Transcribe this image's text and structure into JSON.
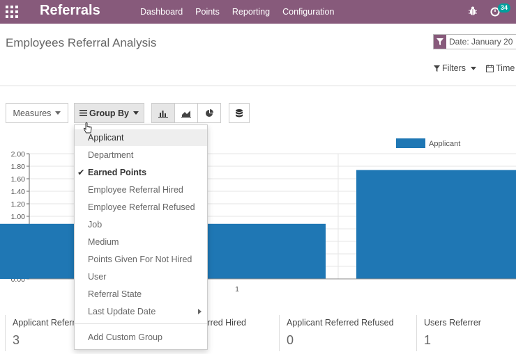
{
  "navbar": {
    "app_title": "Referrals",
    "menu": [
      "Dashboard",
      "Points",
      "Reporting",
      "Configuration"
    ],
    "activity_count": "34",
    "bg_color": "#875a7b"
  },
  "control_panel": {
    "page_title": "Employees Referral Analysis",
    "date_facet": "Date: January 20",
    "filters_label": "Filters",
    "time_ranges_label": "Time"
  },
  "buttons": {
    "measures_label": "Measures",
    "group_by_label": "Group By",
    "chart_types": [
      "bar-chart-icon",
      "line-chart-icon",
      "pie-chart-icon"
    ],
    "stack_icon": "database-icon"
  },
  "group_by_menu": {
    "items": [
      {
        "label": "Applicant",
        "state": "hover"
      },
      {
        "label": "Department",
        "state": ""
      },
      {
        "label": "Earned Points",
        "state": "checked"
      },
      {
        "label": "Employee Referral Hired",
        "state": ""
      },
      {
        "label": "Employee Referral Refused",
        "state": ""
      },
      {
        "label": "Job",
        "state": ""
      },
      {
        "label": "Medium",
        "state": ""
      },
      {
        "label": "Points Given For Not Hired",
        "state": ""
      },
      {
        "label": "User",
        "state": ""
      },
      {
        "label": "Referral State",
        "state": ""
      },
      {
        "label": "Last Update Date",
        "state": "submenu"
      }
    ],
    "add_custom_label": "Add Custom Group"
  },
  "chart_data": {
    "type": "bar",
    "categories": [
      "0",
      "1",
      "2"
    ],
    "x_tick_labels": [
      "",
      "1",
      ""
    ],
    "series": [
      {
        "name": "Applicant",
        "values": [
          0.88,
          0.88,
          1.74
        ],
        "color": "#1f77b4"
      }
    ],
    "ylim": [
      0,
      2
    ],
    "y_ticks": [
      "0.00",
      "0.20",
      "0.40",
      "0.60",
      "0.80",
      "1.00",
      "1.20",
      "1.40",
      "1.60",
      "1.80",
      "2.00"
    ],
    "legend": "top-right",
    "grid": true
  },
  "kpis": [
    {
      "label": "Applicant Referred",
      "value": "3"
    },
    {
      "label": "Applicant Referred Hired",
      "value": ""
    },
    {
      "label": "Applicant Referred Refused",
      "value": "0"
    },
    {
      "label": "Users Referrer",
      "value": "1"
    }
  ]
}
